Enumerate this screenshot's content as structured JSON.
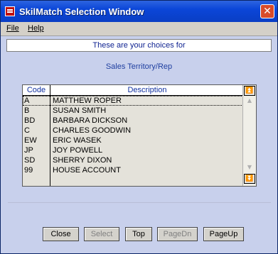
{
  "window": {
    "title": "SkilMatch Selection Window",
    "close_glyph": "✕"
  },
  "menu": {
    "items": [
      {
        "label": "File"
      },
      {
        "label": "Help"
      }
    ]
  },
  "banner": "These are your choices for",
  "subtitle": "Sales Territory/Rep",
  "grid": {
    "columns": {
      "code": "Code",
      "description": "Description"
    },
    "rows": [
      {
        "code": "A",
        "description": "MATTHEW ROPER"
      },
      {
        "code": "B",
        "description": "SUSAN SMITH"
      },
      {
        "code": "BD",
        "description": "BARBARA DICKSON"
      },
      {
        "code": "C",
        "description": "CHARLES GOODWIN"
      },
      {
        "code": "EW",
        "description": "ERIC WASEK"
      },
      {
        "code": "JP",
        "description": "JOY POWELL"
      },
      {
        "code": "SD",
        "description": "SHERRY DIXON"
      },
      {
        "code": "99",
        "description": "HOUSE ACCOUNT"
      }
    ]
  },
  "buttons": {
    "close": "Close",
    "select": "Select",
    "top": "Top",
    "pagedn": "PageDn",
    "pageup": "PageUp"
  },
  "icons": {
    "scroll_top": "scroll-to-top-icon",
    "scroll_up": "scroll-up-arrow-icon",
    "scroll_down": "scroll-down-arrow-icon",
    "scroll_bottom": "scroll-to-bottom-icon"
  },
  "colors": {
    "titlebar": "#0b46d8",
    "accent_text": "#1030a0",
    "background": "#c8d0ec"
  }
}
